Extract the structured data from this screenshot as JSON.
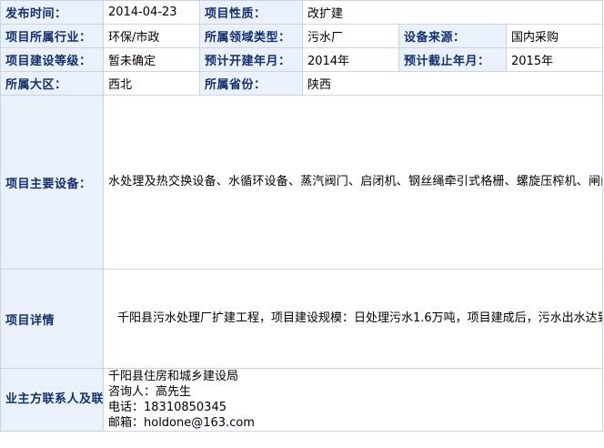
{
  "fields": {
    "publish_time": {
      "label": "发布时间：",
      "value": "2014-04-23"
    },
    "project_nature": {
      "label": "项目性质：",
      "value": "改扩建"
    },
    "industry": {
      "label": "项目所属行业：",
      "value": "环保/市政"
    },
    "domain_type": {
      "label": "所属领域类型：",
      "value": "污水厂"
    },
    "equipment_source": {
      "label": "设备来源：",
      "value": "国内采购"
    },
    "construction_level": {
      "label": "项目建设等级：",
      "value": "暂未确定"
    },
    "planned_start": {
      "label": "预计开建年月：",
      "value": "2014年"
    },
    "planned_end": {
      "label": "预计截止年月：",
      "value": "2015年"
    },
    "region": {
      "label": "所属大区：",
      "value": "西北"
    },
    "province": {
      "label": "所属省份：",
      "value": "陕西"
    }
  },
  "main_equipment": {
    "label": "项目主要设备：",
    "text": "水处理及热交换设备、水循环设备、蒸汽阀门、启闭机、钢丝绳牵引式格栅、螺旋压榨机、闸门、粗细格栅、除砂系统、潜水搅拌器、鼓风机、微孔曝气管、刮泥机、紫外消毒系统、带式污泥浓缩脱水一体机、各类检测仪器、泵、空气压缩机、罗茨鼓风机、离心鼓风机、表面曝气机、自动取水样机、格栅清污机、刮砂机、刮泥机、刮泥吸泥机、污泥浓缩刮泥机、消化池污泥搅拌设备、沼气锅炉、热交换器、药液搅拌机、污泥脱水机、交直流电动机、变速电机、启动开关设备、离心机、旋转式滚筒筛分机、超声波液位传感器、、螺旋给料机、气氛紧缩机等"
  },
  "project_detail": {
    "label": "项目详情",
    "text": "千阳县污水处理厂扩建工程，项目建设规模：日处理污水1.6万吨，项目建成后，污水出水达到《城镇污水处理厂污染物排放标准》（GB18918-2002）及《黄河流域（陕西段）污水综合排放标准》（DB61/224-2011）一级A标准，主要采用水解酸化+曝气生物滤池工艺。"
  },
  "contact": {
    "label": "业主方联系人及联系方式：",
    "org": "千阳县住房和城乡建设局",
    "person": "咨询人：高先生",
    "phone": "电话：18310850345",
    "email": "邮箱：holdone@163.com"
  },
  "colors": {
    "label_bg": "#eaf1fb",
    "label_text": "#12306e",
    "border": "#c7d5e6"
  }
}
